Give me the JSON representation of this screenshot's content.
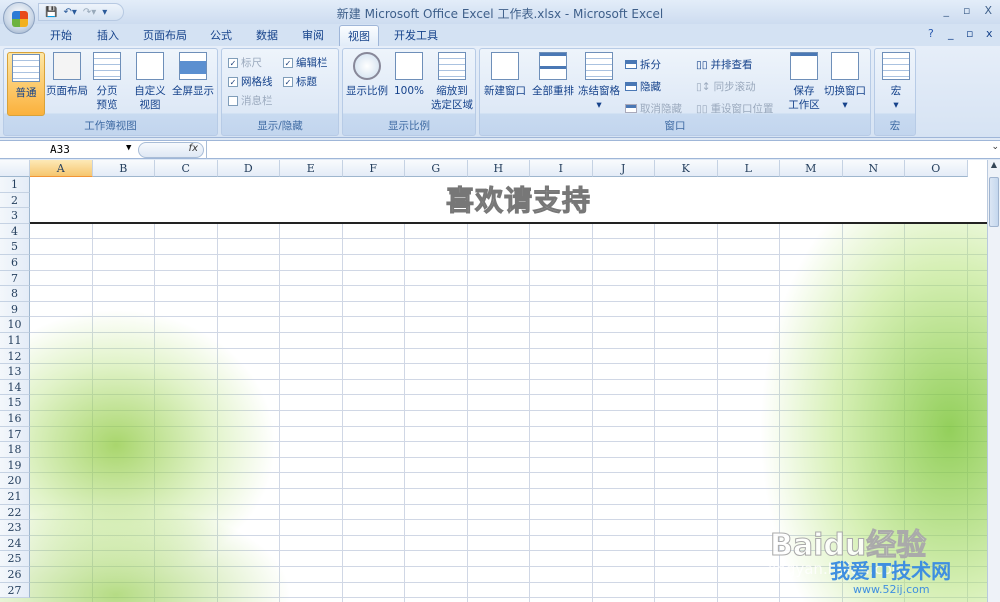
{
  "window": {
    "title": "新建 Microsoft Office Excel 工作表.xlsx - Microsoft Excel",
    "controls": [
      "_",
      "▫",
      "X"
    ]
  },
  "quick_access": {
    "save": "save-icon",
    "undo": "undo-icon",
    "redo": "redo-icon",
    "customize": "▾"
  },
  "tabs": [
    "开始",
    "插入",
    "页面布局",
    "公式",
    "数据",
    "审阅",
    "视图",
    "开发工具"
  ],
  "active_tab": "视图",
  "ribbon": {
    "workbook_views": {
      "label": "工作簿视图",
      "buttons": [
        "普通",
        "页面布局",
        "分页\n预览",
        "自定义\n视图",
        "全屏显示"
      ]
    },
    "show_hide": {
      "label": "显示/隐藏",
      "items": [
        {
          "label": "标尺",
          "checked": true,
          "disabled": true
        },
        {
          "label": "编辑栏",
          "checked": true
        },
        {
          "label": "网格线",
          "checked": true
        },
        {
          "label": "标题",
          "checked": true
        },
        {
          "label": "消息栏",
          "checked": false,
          "disabled": true
        }
      ]
    },
    "zoom": {
      "label": "显示比例",
      "buttons": [
        "显示比例",
        "100%",
        "缩放到\n选定区域"
      ]
    },
    "window": {
      "label": "窗口",
      "buttons": [
        "新建窗口",
        "全部重排",
        "冻结窗格"
      ],
      "small": [
        "拆分",
        "隐藏",
        "取消隐藏",
        "并排查看",
        "同步滚动",
        "重设窗口位置"
      ],
      "save_ws": "保存\n工作区",
      "switch": "切换窗口"
    },
    "macros": {
      "label": "宏",
      "button": "宏"
    }
  },
  "formula_bar": {
    "name_box": "A33",
    "fx": "fx",
    "value": ""
  },
  "columns": [
    "A",
    "B",
    "C",
    "D",
    "E",
    "F",
    "G",
    "H",
    "I",
    "J",
    "K",
    "L",
    "M",
    "N",
    "O"
  ],
  "selected_column": "A",
  "rows": [
    "1",
    "2",
    "3",
    "4",
    "5",
    "6",
    "7",
    "8",
    "9",
    "10",
    "11",
    "12",
    "13",
    "14",
    "15",
    "16",
    "17",
    "18",
    "19",
    "20",
    "21",
    "22",
    "23",
    "24",
    "25",
    "26",
    "27"
  ],
  "sheet": {
    "heading": "喜欢请支持"
  },
  "watermarks": {
    "baidu": "Baidu经验",
    "baidu_url": "jingyan.baidu.com",
    "site": "我爱IT技术网",
    "site_url": "www.52ij.com"
  }
}
